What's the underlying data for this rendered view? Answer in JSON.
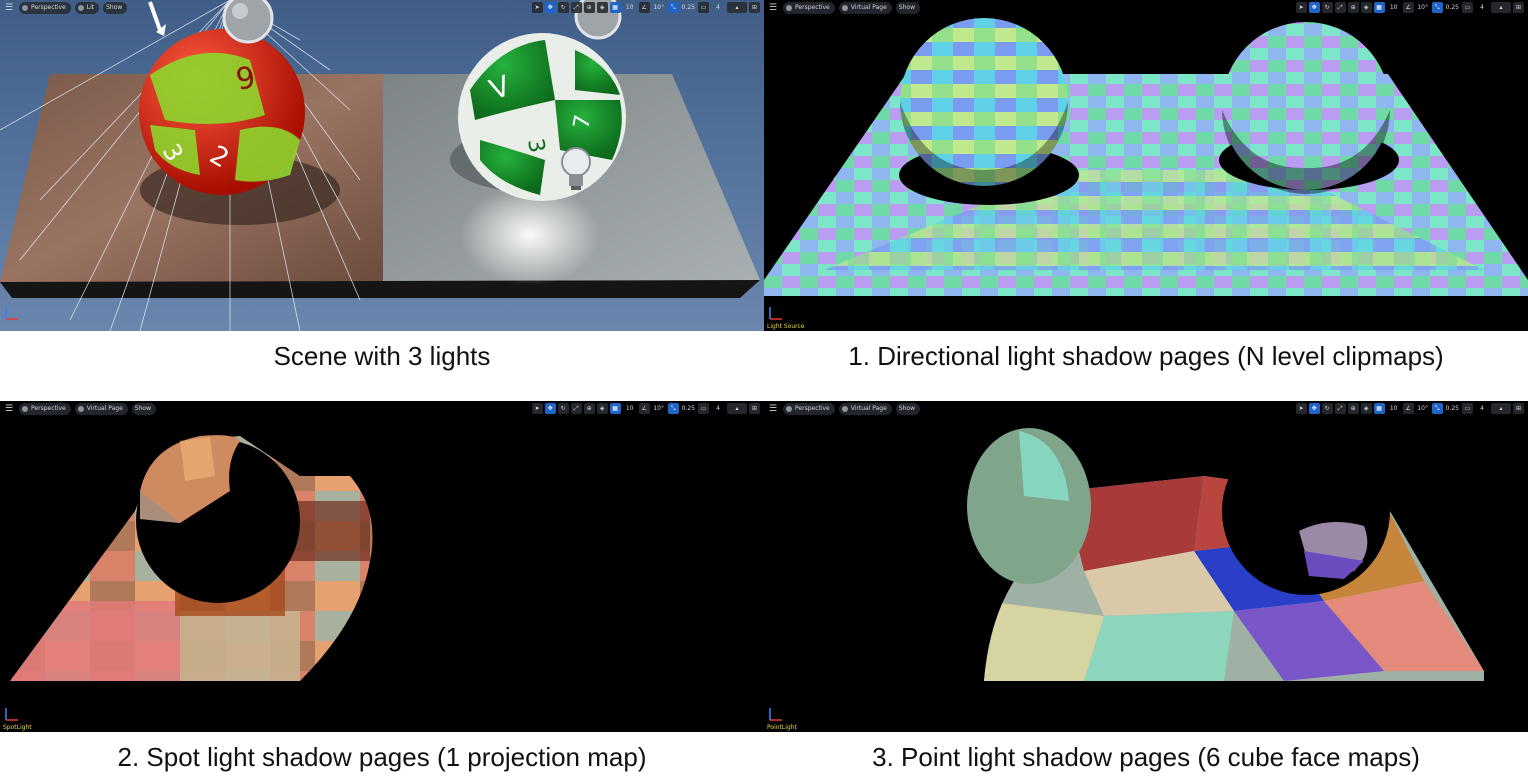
{
  "panels": [
    {
      "id": "scene",
      "caption": "Scene with 3 lights",
      "viewport_label": "",
      "toolbar": {
        "mode": "Perspective",
        "view": "Lit",
        "show": "Show",
        "grid": "10",
        "angle": "10°",
        "scale": "0.25",
        "cam": "4"
      }
    },
    {
      "id": "directional",
      "caption": "1. Directional light shadow pages (N level clipmaps)",
      "viewport_label": "Light Source",
      "toolbar": {
        "mode": "Perspective",
        "view": "Virtual Page",
        "show": "Show",
        "grid": "10",
        "angle": "10°",
        "scale": "0.25",
        "cam": "4"
      }
    },
    {
      "id": "spot",
      "caption": "2. Spot light shadow pages (1 projection map)",
      "viewport_label": "SpotLight",
      "toolbar": {
        "mode": "Perspective",
        "view": "Virtual Page",
        "show": "Show",
        "grid": "10",
        "angle": "10°",
        "scale": "0.25",
        "cam": "4"
      }
    },
    {
      "id": "point",
      "caption": "3. Point light shadow pages (6 cube face maps)",
      "viewport_label": "PointLight",
      "toolbar": {
        "mode": "Perspective",
        "view": "Virtual Page",
        "show": "Show",
        "grid": "10",
        "angle": "10°",
        "scale": "0.25",
        "cam": "4"
      }
    }
  ]
}
